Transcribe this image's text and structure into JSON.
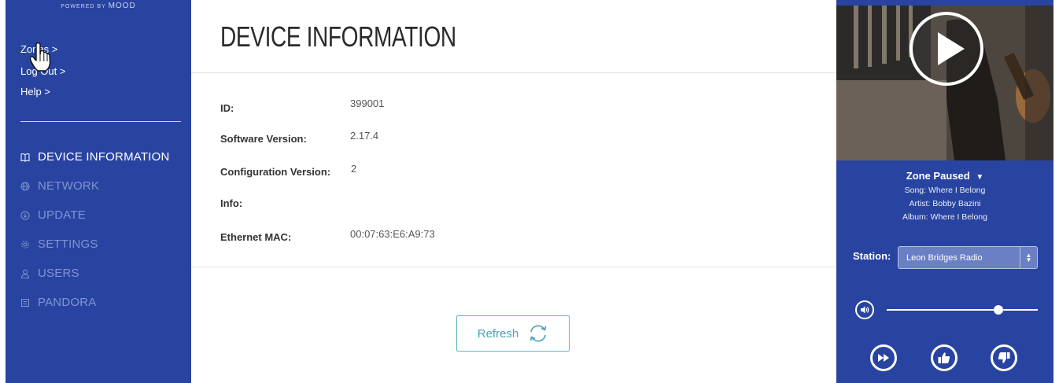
{
  "brand": {
    "powered_by": "POWERED BY",
    "name": "MOOD"
  },
  "sidebar": {
    "links": [
      {
        "label": "Zones >"
      },
      {
        "label": "Log Out >"
      },
      {
        "label": "Help >"
      }
    ],
    "nav": [
      {
        "label": "DEVICE INFORMATION",
        "icon": "book-icon",
        "active": true
      },
      {
        "label": "NETWORK",
        "icon": "globe-icon",
        "active": false
      },
      {
        "label": "UPDATE",
        "icon": "cloud-download-icon",
        "active": false
      },
      {
        "label": "SETTINGS",
        "icon": "gear-icon",
        "active": false
      },
      {
        "label": "USERS",
        "icon": "user-icon",
        "active": false
      },
      {
        "label": "PANDORA",
        "icon": "pandora-icon",
        "active": false
      }
    ]
  },
  "main": {
    "title": "DEVICE INFORMATION",
    "fields": [
      {
        "label": "ID:",
        "value": "399001"
      },
      {
        "label": "Software Version:",
        "value": "2.17.4"
      },
      {
        "label": "Configuration Version:",
        "value": "2"
      },
      {
        "label": "Info:",
        "value": ""
      },
      {
        "label": "Ethernet MAC:",
        "value": "00:07:63:E6:A9:73"
      }
    ],
    "refresh_label": "Refresh"
  },
  "player": {
    "status": "Zone Paused",
    "song": "Song: Where I Belong",
    "artist": "Artist: Bobby Bazini",
    "album": "Album: Where I Belong",
    "station_label": "Station:",
    "station_selected": "Leon Bridges Radio",
    "volume_percent": 74,
    "controls": [
      "skip-icon",
      "thumbs-up-icon",
      "thumbs-down-icon"
    ]
  },
  "colors": {
    "panel_blue": "#2944a0",
    "nav_inactive": "#7f94d2",
    "refresh_accent": "#4aa3b9"
  }
}
